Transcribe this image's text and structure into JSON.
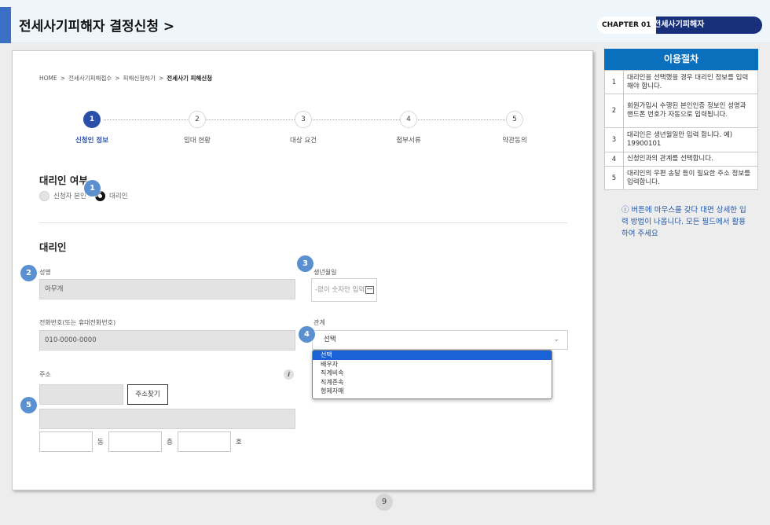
{
  "header": {
    "title": "전세사기피해자 결정신청 >",
    "chapter_label": "CHAPTER 01",
    "chapter_name": "전세사기피해자"
  },
  "breadcrumb": [
    "HOME",
    "전세사기피해접수",
    "피해신청하기",
    "전세사기 피해신청"
  ],
  "steps": [
    {
      "num": "1",
      "label": "신청인 정보"
    },
    {
      "num": "2",
      "label": "임대 현황"
    },
    {
      "num": "3",
      "label": "대상 요건"
    },
    {
      "num": "4",
      "label": "첨부서류"
    },
    {
      "num": "5",
      "label": "약관동의"
    }
  ],
  "agent_choice": {
    "title": "대리인 여부",
    "options": [
      "신청자 본인",
      "대리인"
    ],
    "selected": "대리인"
  },
  "agent_section": {
    "title": "대리인",
    "name_label": "성명",
    "name_value": "아무개",
    "birth_label": "생년월일",
    "birth_placeholder": "-없이 숫자만 입력",
    "phone_label": "전화번호(또는 휴대전화번호)",
    "phone_value": "010-0000-0000",
    "relation_label": "관계",
    "relation_selected": "선택",
    "relation_options": [
      "선택",
      "배우자",
      "직계비속",
      "직계존속",
      "형제자매"
    ],
    "address_label": "주소",
    "address_info_icon": "i",
    "address_search_button": "주소찾기",
    "unit_labels": [
      "동",
      "층",
      "호"
    ]
  },
  "badges": [
    "1",
    "2",
    "3",
    "4",
    "5"
  ],
  "page_number": "9",
  "procedure": {
    "title": "이용절차",
    "items": [
      {
        "num": "1",
        "text": "대리인을 선택했을 경우 대리인 정보를 입력해야 합니다."
      },
      {
        "num": "2",
        "text": "회원가입시 수행된 본인인증 정보인 성명과 핸드폰 번호가 자동으로 입력됩니다."
      },
      {
        "num": "3",
        "text": "대리인은 생년월일만 입력 합니다. 예) 19900101"
      },
      {
        "num": "4",
        "text": "신청인과의 관계를 선택합니다."
      },
      {
        "num": "5",
        "text": "대리인의 우편 송달 등이 필요한 주소 정보를 입력합니다."
      }
    ],
    "note": "ⓘ 버튼에 마우스를 갖다 대면 상세한 입력 방법이 나옵니다. 모든 필드에서 활용하여 주세요"
  },
  "colors": {
    "accent": "#2b4fa8",
    "badge": "#5a8fd0",
    "procedure_header": "#0a6fbd",
    "chapter_pill": "#18307a"
  }
}
